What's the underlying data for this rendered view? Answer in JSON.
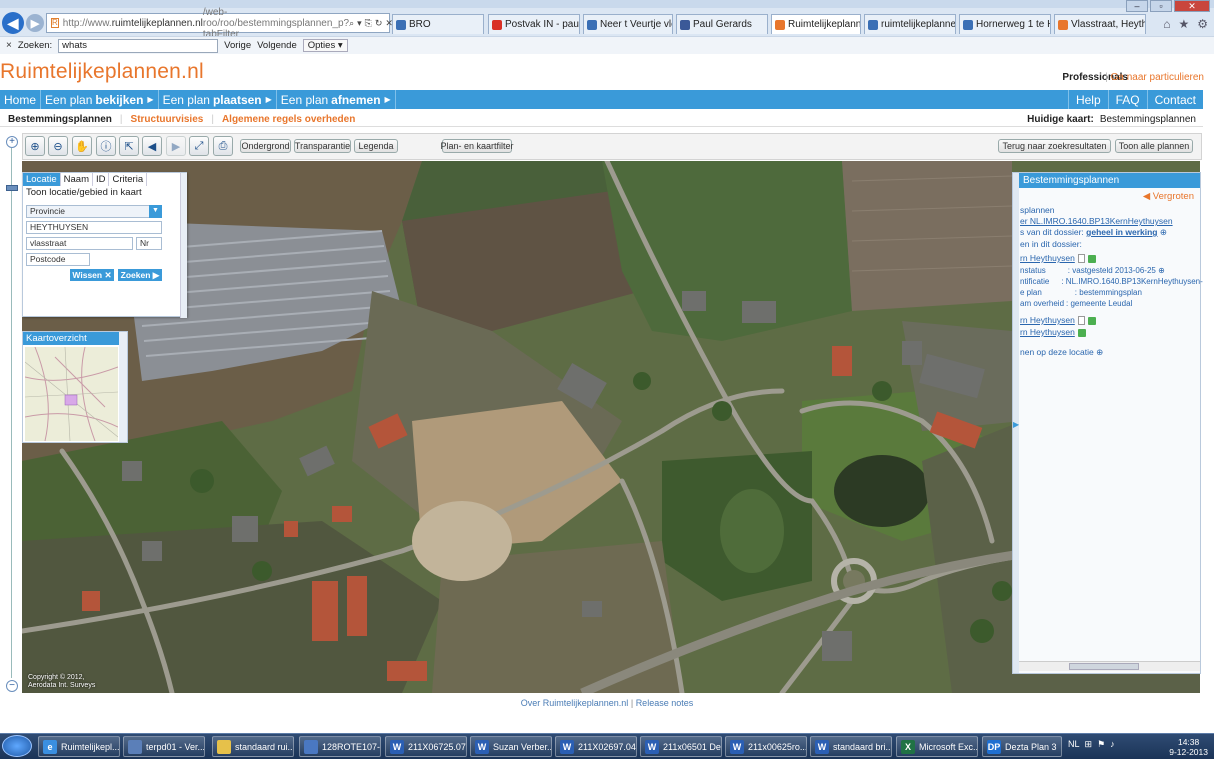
{
  "browser": {
    "url_prefix": "http://www.",
    "url_domain": "ruimtelijkeplannen.nl",
    "url_rest": "/web-roo/roo/bestemmingsplannen_p?tabFilter",
    "tabs": [
      {
        "label": "BRO",
        "icon_color": "#3a6fb5",
        "active": false
      },
      {
        "label": "Postvak IN - paul.ger...",
        "icon_color": "#d93025",
        "active": false
      },
      {
        "label": "Neer t Veurtje vleerm...",
        "icon_color": "#3a6fb5",
        "active": false
      },
      {
        "label": "Paul Gerards",
        "icon_color": "#3b5998",
        "active": false
      },
      {
        "label": "Ruimtelijkeplanne...",
        "icon_color": "#e8762c",
        "active": true
      },
      {
        "label": "ruimtelijkeplannen.nl",
        "icon_color": "#3a6fb5",
        "active": false
      },
      {
        "label": "Hornerweg 1 te Hael...",
        "icon_color": "#3a6fb5",
        "active": false
      },
      {
        "label": "Vlasstraat, Heythuys...",
        "icon_color": "#e8762c",
        "active": false
      }
    ],
    "find": {
      "close": "×",
      "label": "Zoeken:",
      "value": "whats",
      "prev": "Vorige",
      "next": "Volgende",
      "options": "Opties"
    }
  },
  "site": {
    "logo": "Ruimtelijkeplannen.nl",
    "professionals": "Professionals",
    "particulieren_sep": "|",
    "particulieren": "Ga naar particulieren",
    "nav": {
      "home": "Home",
      "items": [
        {
          "pre": "Een plan",
          "bold": "bekijken"
        },
        {
          "pre": "Een plan",
          "bold": "plaatsen"
        },
        {
          "pre": "Een plan",
          "bold": "afnemen"
        }
      ],
      "right": [
        "Help",
        "FAQ",
        "Contact"
      ]
    },
    "subnav": [
      "Bestemmingsplannen",
      "Structuurvisies",
      "Algemene regels overheden"
    ],
    "huidige_label": "Huidige kaart:",
    "huidige_value": "Bestemmingsplannen"
  },
  "toolbar": {
    "icons": [
      "zoom-in-icon",
      "zoom-out-icon",
      "pan-hand-icon",
      "info-icon",
      "measure-icon",
      "previous-extent-icon",
      "next-extent-icon",
      "full-extent-icon",
      "print-icon"
    ],
    "pills": [
      "Ondergrond",
      "Transparantie",
      "Legenda",
      "Plan- en kaartfilter"
    ],
    "right_buttons": [
      "Terug naar zoekresultaten",
      "Toon alle plannen"
    ]
  },
  "search": {
    "tabs": [
      "Locatie",
      "Naam",
      "ID",
      "Criteria"
    ],
    "title": "Toon locatie/gebied in kaart",
    "provincie": "Provincie",
    "plaats": "HEYTHUYSEN",
    "straat": "vlasstraat",
    "nr": "Nr",
    "postcode": "Postcode",
    "wissen": "Wissen",
    "zoeken": "Zoeken"
  },
  "overview": {
    "title": "Kaartoverzicht"
  },
  "map": {
    "copyright_line1": "Copyright © 2012,",
    "copyright_line2": "Aerodata Int. Surveys"
  },
  "rightpanel": {
    "title": "Bestemmingsplannen",
    "vergroten": "Vergroten",
    "l1": "splannen",
    "l2": "er NL.IMRO.1640.BP13KernHeythuysen",
    "l3_pre": "s van dit dossier:",
    "l3_val": "geheel in werking",
    "l4": "en in dit dossier:",
    "plan1": "rn Heythuysen",
    "rows": [
      {
        "k": "nstatus",
        "v": ": vastgesteld 2013-06-25"
      },
      {
        "k": "ntificatie",
        "v": ": NL.IMRO.1640.BP13KernHeythuysen-"
      },
      {
        "k": "e plan",
        "v": ": bestemmingsplan"
      },
      {
        "k": "am overheid",
        "v": ": gemeente Leudal"
      }
    ],
    "plan2": "rn Heythuysen",
    "plan3": "rn Heythuysen",
    "l_last": "nen op deze locatie"
  },
  "footer": {
    "about": "Over Ruimtelijkeplannen.nl",
    "sep": "|",
    "release": "Release notes"
  },
  "taskbar": {
    "items": [
      {
        "label": "Ruimtelijkepl...",
        "icon": "e",
        "icon_color": "#3a8fe0"
      },
      {
        "label": "terpd01 - Ver...",
        "icon": "",
        "icon_color": "#5b7fb8"
      },
      {
        "label": "standaard rui...",
        "icon": "",
        "icon_color": "#e6c14a"
      },
      {
        "label": "128ROTE107-...",
        "icon": "",
        "icon_color": "#4a78c2"
      },
      {
        "label": "211X06725.07...",
        "icon": "W",
        "icon_color": "#2b5fb4"
      },
      {
        "label": "Suzan Verber...",
        "icon": "W",
        "icon_color": "#2b5fb4"
      },
      {
        "label": "211X02697.04...",
        "icon": "W",
        "icon_color": "#2b5fb4"
      },
      {
        "label": "211x06501 De...",
        "icon": "W",
        "icon_color": "#2b5fb4"
      },
      {
        "label": "211x00625ro...",
        "icon": "W",
        "icon_color": "#2b5fb4"
      },
      {
        "label": "standaard bri...",
        "icon": "W",
        "icon_color": "#2b5fb4"
      },
      {
        "label": "Microsoft Exc...",
        "icon": "X",
        "icon_color": "#207245"
      },
      {
        "label": "Dezta Plan 3",
        "icon": "DP",
        "icon_color": "#1f6fd1"
      }
    ],
    "tray_lang": "NL",
    "time": "14:38",
    "date": "9-12-2013"
  }
}
